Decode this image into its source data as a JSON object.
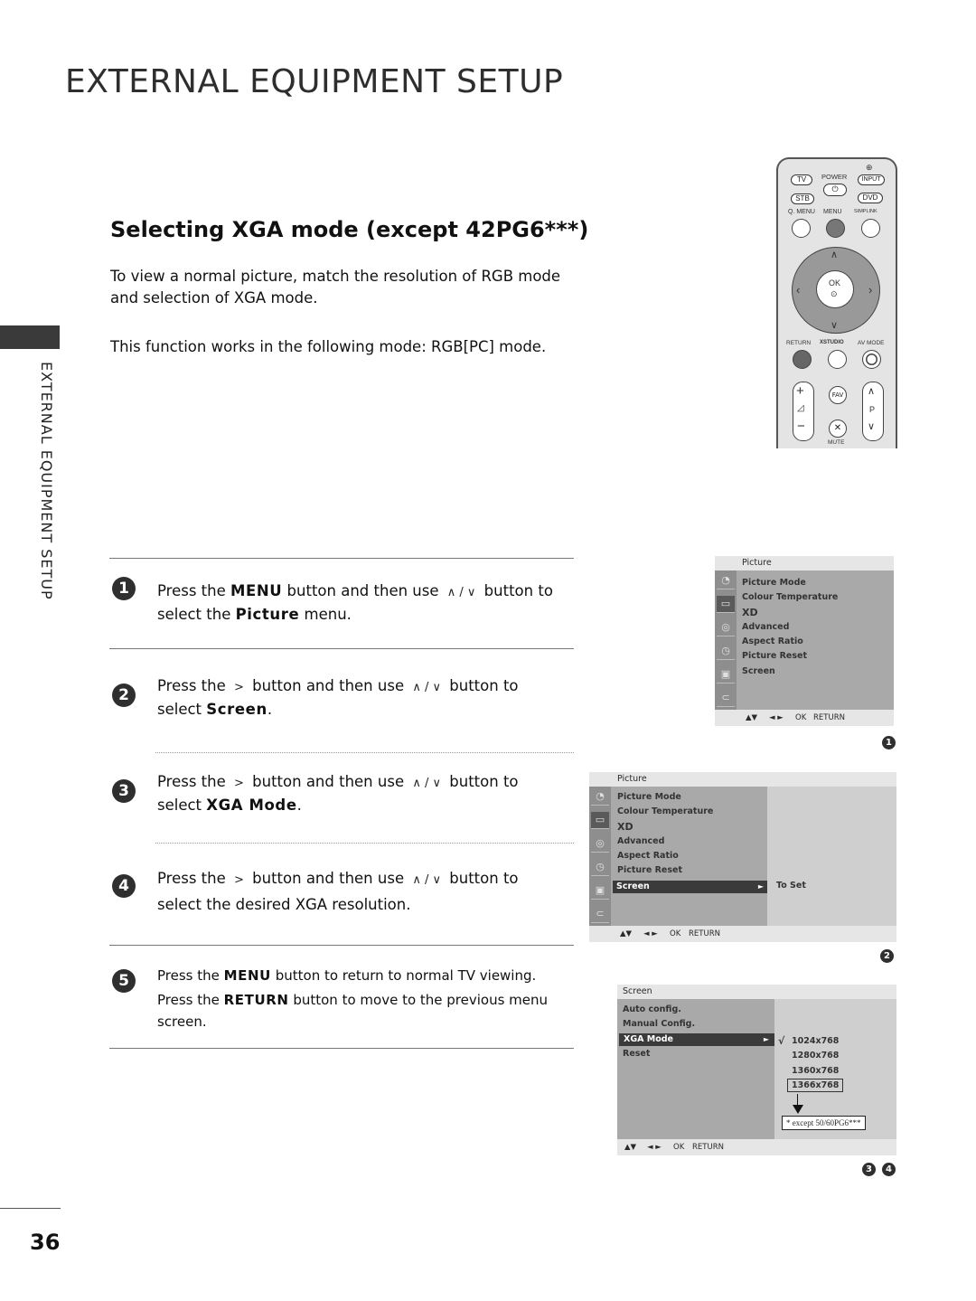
{
  "page": {
    "title": "EXTERNAL EQUIPMENT SETUP",
    "side_label": "EXTERNAL EQUIPMENT SETUP",
    "page_number": "36"
  },
  "section": {
    "title": "Selecting XGA mode (except 42PG6***)",
    "intro": "To view a normal picture, match the resolution of RGB mode and selection of XGA mode.",
    "mode_note": "This function works in the following mode: RGB[PC] mode."
  },
  "steps": [
    {
      "number": "1",
      "parts": [
        "Press the ",
        "MENU",
        " button and then use ",
        "∧ / ∨",
        " button to select the ",
        "Picture",
        " menu."
      ]
    },
    {
      "number": "2",
      "parts": [
        "Press the ",
        ">",
        " button and then use ",
        "∧ / ∨",
        " button to select ",
        "Screen",
        "."
      ]
    },
    {
      "number": "3",
      "parts": [
        "Press the ",
        ">",
        " button and then use ",
        "∧ / ∨",
        " button to select ",
        "XGA Mode",
        "."
      ]
    },
    {
      "number": "4",
      "parts": [
        "Press the ",
        ">",
        " button and then use ",
        "∧ / ∨",
        " button to select the desired XGA resolution."
      ]
    },
    {
      "number": "5",
      "line1": [
        "Press the ",
        "MENU",
        " button to return to normal TV viewing."
      ],
      "line2": [
        "Press the ",
        "RETURN",
        " button to move to the previous menu screen."
      ]
    }
  ],
  "remote": {
    "tv": "TV",
    "power": "POWER",
    "input": "INPUT",
    "stb": "STB",
    "dvd": "DVD",
    "qmenu": "Q. MENU",
    "menu": "MENU",
    "simplink": "SIMPLINK",
    "ok": "OK",
    "return": "RETURN",
    "xstudio": "XSTUDIO",
    "avmode": "AV MODE",
    "fav": "FAV",
    "p": "P",
    "mute": "MUTE",
    "plus": "+",
    "minus": "−",
    "vol": "◿"
  },
  "osd1": {
    "header": "Picture",
    "items": [
      "Picture Mode",
      "Colour Temperature",
      "XD",
      "Advanced",
      "Aspect Ratio",
      "Picture Reset",
      "Screen"
    ],
    "footer": [
      "▲▼",
      "◄ ►",
      "OK",
      "RETURN"
    ],
    "badge": "1"
  },
  "osd2": {
    "header": "Picture",
    "items": [
      "Picture Mode",
      "Colour Temperature",
      "XD",
      "Advanced",
      "Aspect Ratio",
      "Picture Reset",
      "Screen"
    ],
    "selected_index": 6,
    "arrow": "►",
    "submenu_value": "To Set",
    "footer": [
      "▲▼",
      "◄ ►",
      "OK",
      "RETURN"
    ],
    "badge": "2"
  },
  "osd3": {
    "header": "Screen",
    "items": [
      "Auto config.",
      "Manual Config.",
      "XGA Mode",
      "Reset"
    ],
    "selected_index": 2,
    "arrow": "►",
    "check": "√",
    "options": [
      "1024x768",
      "1280x768",
      "1360x768",
      "1366x768"
    ],
    "checked_option": "1024x768",
    "note": "* except 50/60PG6***",
    "footer": [
      "▲▼",
      "◄ ►",
      "OK",
      "RETURN"
    ],
    "badges": [
      "3",
      "4"
    ]
  },
  "colors": {
    "menu_bg": "#a9a9a9",
    "menu_header": "#e6e6e6",
    "menu_selected": "#3b3b3b",
    "menu_button_remote": "#777777",
    "badge": "#2f2f2f"
  }
}
